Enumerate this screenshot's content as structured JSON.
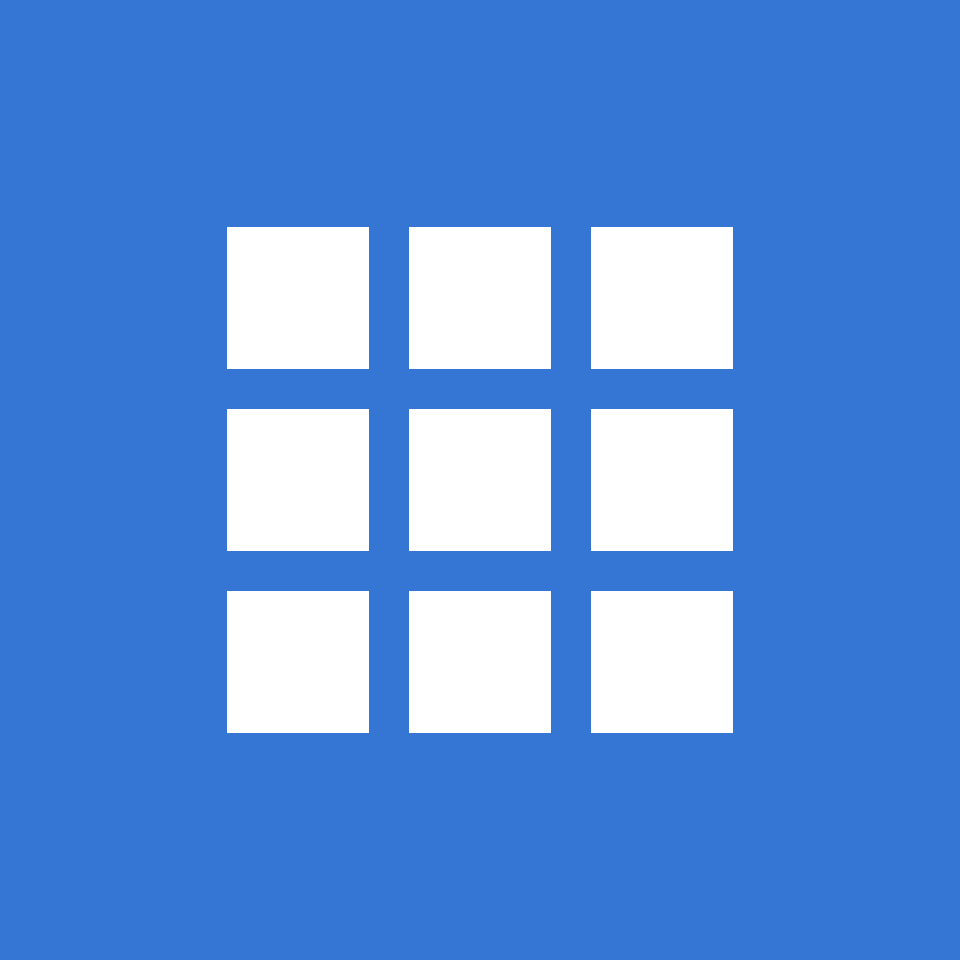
{
  "icon": {
    "name": "grid-icon",
    "background_color": "#3576d4",
    "tile_color": "#ffffff",
    "rows": 3,
    "columns": 3
  }
}
